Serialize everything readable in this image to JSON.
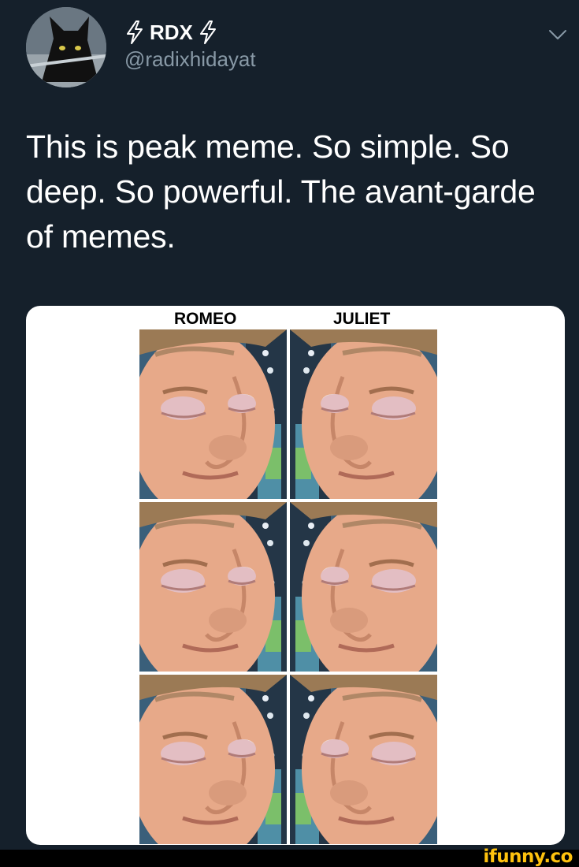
{
  "tweet": {
    "author": {
      "display_name": "RDX",
      "name_prefix_icon": "lightning-bolt-icon",
      "name_suffix_icon": "lightning-bolt-icon",
      "handle": "@radixhidayat",
      "avatar": "black-cat-avatar"
    },
    "menu_icon": "chevron-down-icon",
    "text": "This is peak meme. So simple. So deep. So powerful. The avant-garde of memes.",
    "media": {
      "labels": {
        "left": "ROMEO",
        "right": "JULIET"
      },
      "panels": [
        {
          "row": 1,
          "column": "ROMEO",
          "eyes": "open",
          "facing": "right"
        },
        {
          "row": 1,
          "column": "JULIET",
          "eyes": "closed",
          "facing": "left"
        },
        {
          "row": 2,
          "column": "ROMEO",
          "eyes": "closed",
          "facing": "right"
        },
        {
          "row": 2,
          "column": "JULIET",
          "eyes": "open",
          "facing": "left"
        },
        {
          "row": 3,
          "column": "ROMEO",
          "eyes": "closed",
          "facing": "right"
        },
        {
          "row": 3,
          "column": "JULIET",
          "eyes": "closed",
          "facing": "left"
        }
      ]
    }
  },
  "watermark": "ifunny.co",
  "colors": {
    "background": "#15202b",
    "text": "#ffffff",
    "secondary_text": "#8899a6",
    "bolt": "#ffffff",
    "watermark": "#ffc20e"
  }
}
